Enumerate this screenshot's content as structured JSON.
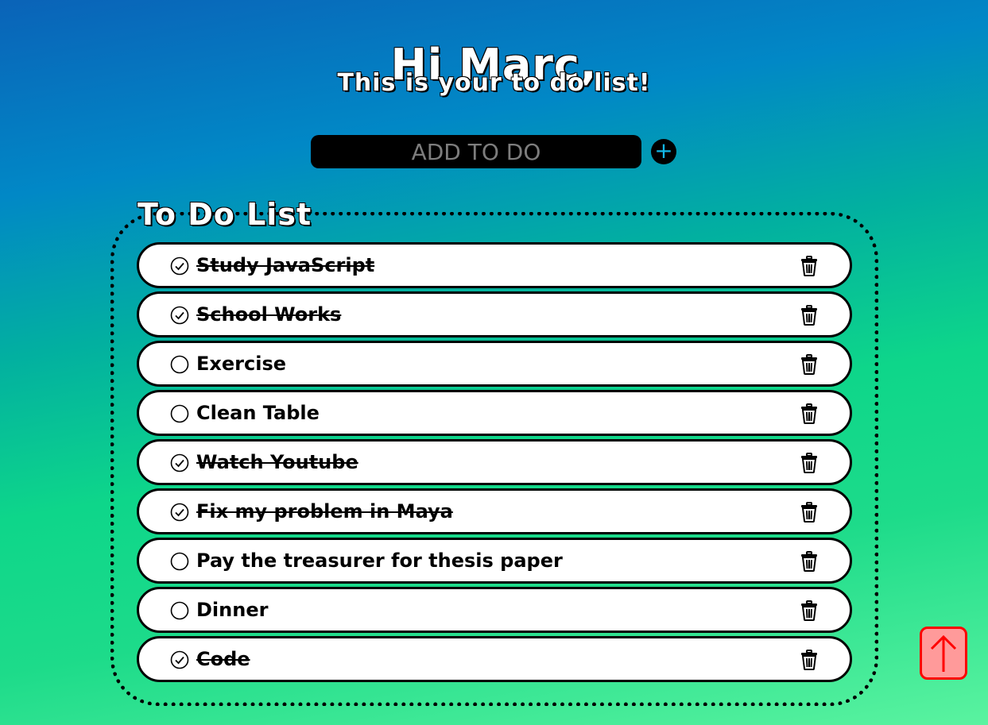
{
  "header": {
    "greeting": "Hi Marc,",
    "subtitle": "This is your to do list!"
  },
  "add_todo": {
    "placeholder": "ADD TO DO",
    "value": "",
    "button_icon": "plus-icon",
    "button_label": "+"
  },
  "list": {
    "title": "To Do List",
    "items": [
      {
        "text": "Study JavaScript",
        "done": true
      },
      {
        "text": "School Works",
        "done": true
      },
      {
        "text": "Exercise",
        "done": false
      },
      {
        "text": "Clean Table",
        "done": false
      },
      {
        "text": "Watch Youtube",
        "done": true
      },
      {
        "text": "Fix my problem in Maya",
        "done": true
      },
      {
        "text": "Pay the treasurer for thesis paper",
        "done": false
      },
      {
        "text": "Dinner",
        "done": false
      },
      {
        "text": "Code",
        "done": true
      }
    ],
    "done_icon": "check-circle-icon",
    "undone_icon": "empty-circle-icon",
    "delete_icon": "trash-icon"
  },
  "scroll_top": {
    "icon": "arrow-up-icon"
  },
  "colors": {
    "gradient_top": "#0a63b8",
    "gradient_middle": "#0ed68a",
    "gradient_bottom": "#5af3a0",
    "input_bg": "#000000",
    "add_button_plus": "#12b8e8",
    "scroll_top_bg": "#ff9a9a",
    "scroll_top_border": "#ff0000"
  }
}
